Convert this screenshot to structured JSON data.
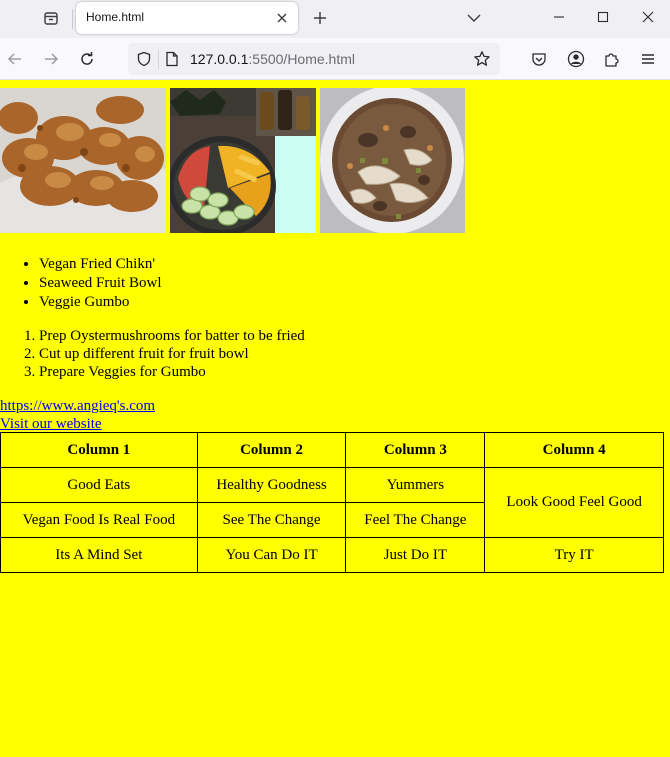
{
  "browser": {
    "tab": {
      "title": "Home.html"
    },
    "url": {
      "host": "127.0.0.1",
      "rest": ":5500/Home.html"
    }
  },
  "page": {
    "images": [
      {
        "icon": "fried-chicken-photo"
      },
      {
        "icon": "seaweed-fruit-bowl-photo"
      },
      {
        "icon": "veggie-gumbo-photo"
      }
    ],
    "unordered_list": [
      "Vegan Fried Chikn'",
      "Seaweed Fruit Bowl",
      "Veggie Gumbo"
    ],
    "ordered_list": [
      "Prep Oystermushrooms for batter to be fried",
      "Cut up different fruit for fruit bowl",
      "Prepare Veggies for Gumbo"
    ],
    "links": [
      "https://www.angieq's.com",
      "Visit our website"
    ],
    "table": {
      "headers": [
        "Column 1",
        "Column 2",
        "Column 3",
        "Column 4"
      ],
      "rows": [
        [
          "Good Eats",
          "Healthy Goodness",
          "Yummers",
          "Look Good Feel Good"
        ],
        [
          "Vegan Food Is Real Food",
          "See The Change",
          "Feel The Change"
        ],
        [
          "Its A Mind Set",
          "You Can Do IT",
          "Just Do IT",
          "Try IT"
        ]
      ]
    },
    "colors": {
      "background": "#ffff00",
      "link": "#0000ee"
    }
  }
}
